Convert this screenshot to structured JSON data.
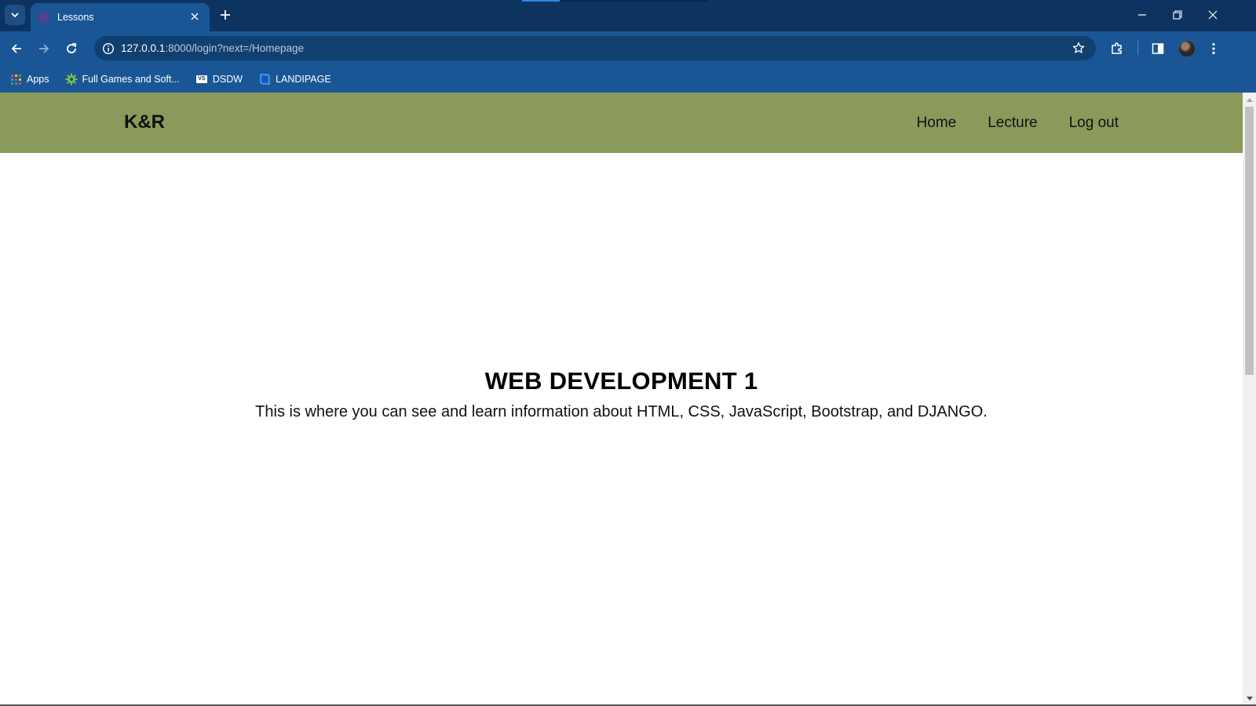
{
  "browser": {
    "tab": {
      "title": "Lessons"
    },
    "address": {
      "host": "127.0.0.1",
      "rest": ":8000/login?next=/Homepage"
    },
    "bookmarks": [
      {
        "label": "Apps",
        "icon": "apps-grid-icon"
      },
      {
        "label": "Full Games and Soft...",
        "icon": "gear-icon"
      },
      {
        "label": "DSDW",
        "icon": "vs-icon"
      },
      {
        "label": "LANDIPAGE",
        "icon": "bookmark-site-icon"
      }
    ]
  },
  "site": {
    "brand": "K&R",
    "nav": [
      "Home",
      "Lecture",
      "Log out"
    ],
    "nav_color": "#8a9a5b"
  },
  "hero": {
    "title": "WEB DEVELOPMENT 1",
    "description": "This is where you can see and learn information about HTML, CSS, JavaScript, Bootstrap, and DJANGO."
  },
  "colors": {
    "tabbar": "#0d3461",
    "toolbar": "#1a5696",
    "omnibox": "#10406f"
  }
}
